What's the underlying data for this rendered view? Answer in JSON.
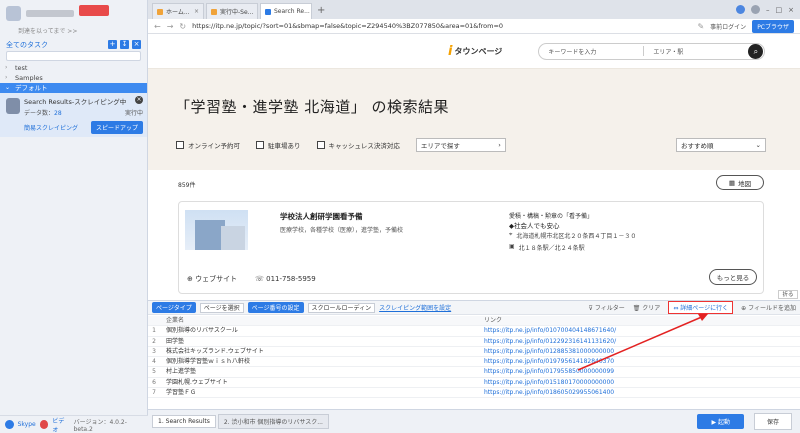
{
  "sidebar": {
    "collapse_link": "到達を以ってまで >>",
    "tasks_header": "全てのタスク",
    "tree": [
      "test",
      "Samples",
      "デフォルト"
    ],
    "task": {
      "title": "Search Results-スクレイピング中",
      "data_label": "データ数：",
      "data_count": "28",
      "status": "実行中",
      "mode": "簡易スクレイピング",
      "speed_button": "スピードアップ"
    },
    "footer": {
      "link1": "Skype",
      "link2": "ビデオ",
      "version": "バージョン：4.0.2-beta.2"
    }
  },
  "browser": {
    "tabs": [
      "ホーム...",
      "実行中-Se...",
      "Search Re..."
    ],
    "url": "https://itp.ne.jp/topic/?sort=01&sbmap=false&topic=Z294540%3BZ077850&area=01&from=0",
    "login": "事前ログイン",
    "pc_browser": "PCブラウザ"
  },
  "page": {
    "logo_mark": "i",
    "logo_text": "タウンページ",
    "search_keyword": "キーワードを入力",
    "search_area": "エリア・駅",
    "title": "「学習塾・進学塾 北海道」 の検索結果",
    "filters": [
      "オンライン予約可",
      "駐車場あり",
      "キャッシュレス決済対応"
    ],
    "area_select": "エリアで探す",
    "sort_select": "おすすめ順",
    "count": "859件",
    "map_button": "地図",
    "card": {
      "name": "学校法人創研学園看予備",
      "category": "医療学校，各種学校（医療），進学塾，予備校",
      "tags": "愛積・構稿・勲章の「看予備」",
      "catch": "◆社会人でも安心",
      "address": "北海道札幌市北区北２０条西４丁目１－３０",
      "station": "北１８条駅／北２４条駅",
      "website": "ウェブサイト",
      "phone": "011-758-5959",
      "more": "もっと見る"
    }
  },
  "panel": {
    "fold": "折る",
    "page_type": "ページタイプ",
    "page_select": "ページを選択",
    "page_setting": "ページ番号の設定",
    "scroll_select": "スクロールローディン",
    "scraping_range": "スクレイピング範囲を設定",
    "filter": "フィルター",
    "clear": "クリア",
    "go_page": "詳細ページに行く",
    "add_field": "フィールドを追加",
    "columns": [
      "企業名",
      "リンク"
    ],
    "rows": [
      {
        "idx": "1",
        "name": "個別指導のリバサスクール",
        "link": "https://itp.ne.jp/info/010700404148671640/"
      },
      {
        "idx": "2",
        "name": "田学塾",
        "link": "https://itp.ne.jp/info/012292316141131620/"
      },
      {
        "idx": "3",
        "name": "株式会社キッズランド.ウェブサイト",
        "link": "https://itp.ne.jp/info/012885381000000000"
      },
      {
        "idx": "4",
        "name": "個別指導学習塾ｗｉｓｈ八軒校",
        "link": "https://itp.ne.jp/info/019795614182840370"
      },
      {
        "idx": "5",
        "name": "村上進学塾",
        "link": "https://itp.ne.jp/info/017955850000000099"
      },
      {
        "idx": "6",
        "name": "学園札幌.ウェブサイト",
        "link": "https://itp.ne.jp/info/015180170000000000"
      },
      {
        "idx": "7",
        "name": "学習塾ＦＧ",
        "link": "https://itp.ne.jp/info/018605029955061400"
      }
    ],
    "bottom_tabs": [
      "1. Search Results",
      "2. 渋小和市 個別指導のリバサスク..."
    ],
    "start": "▶ 起動",
    "save": "保存"
  }
}
